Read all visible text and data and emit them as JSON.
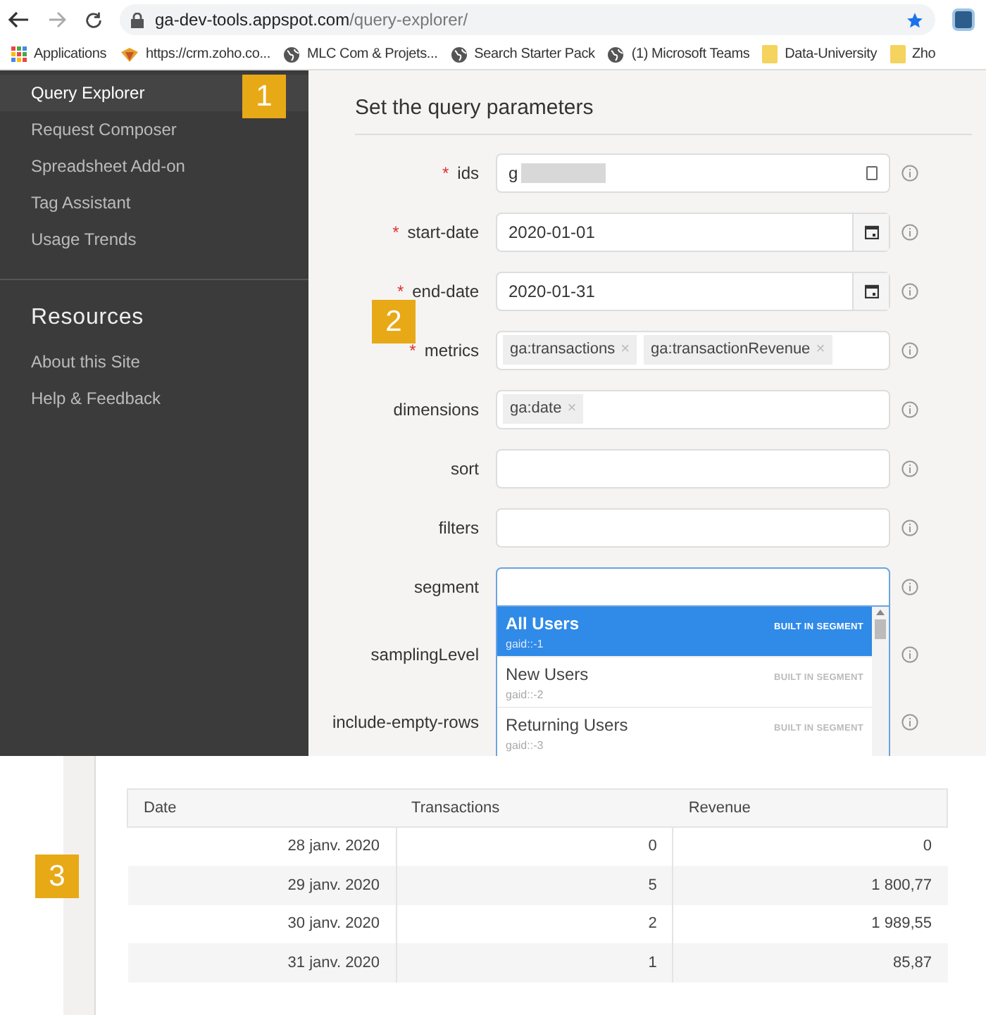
{
  "browser": {
    "url_host": "ga-dev-tools.appspot.com",
    "url_path": "/query-explorer/"
  },
  "bookmarks": [
    {
      "label": "Applications",
      "kind": "apps"
    },
    {
      "label": "https://crm.zoho.co...",
      "kind": "site"
    },
    {
      "label": "MLC Com & Projets...",
      "kind": "globe"
    },
    {
      "label": "Search Starter Pack",
      "kind": "globe"
    },
    {
      "label": "(1) Microsoft Teams",
      "kind": "globe"
    },
    {
      "label": "Data-University",
      "kind": "folder"
    },
    {
      "label": "Zho",
      "kind": "folder"
    }
  ],
  "sidebar": {
    "items": [
      {
        "label": "Query Explorer",
        "selected": true
      },
      {
        "label": "Request Composer",
        "selected": false
      },
      {
        "label": "Spreadsheet Add-on",
        "selected": false
      },
      {
        "label": "Tag Assistant",
        "selected": false
      },
      {
        "label": "Usage Trends",
        "selected": false
      }
    ],
    "resources_heading": "Resources",
    "resources": [
      {
        "label": "About this Site"
      },
      {
        "label": "Help & Feedback"
      }
    ]
  },
  "form": {
    "heading": "Set the query parameters",
    "remove_glyph": "×",
    "fields": [
      {
        "label": "ids",
        "required_mark": "*",
        "kind": "account",
        "value": "g"
      },
      {
        "label": "start-date",
        "required_mark": "*",
        "kind": "date",
        "value": "2020-01-01"
      },
      {
        "label": "end-date",
        "required_mark": "*",
        "kind": "date",
        "value": "2020-01-31"
      },
      {
        "label": "metrics",
        "required_mark": "*",
        "kind": "tags",
        "tags": [
          "ga:transactions",
          "ga:transactionRevenue"
        ]
      },
      {
        "label": "dimensions",
        "kind": "tags",
        "tags": [
          "ga:date"
        ]
      },
      {
        "label": "sort",
        "kind": "text"
      },
      {
        "label": "filters",
        "kind": "text"
      },
      {
        "label": "segment",
        "kind": "segment"
      },
      {
        "label": "samplingLevel",
        "kind": "hidden"
      },
      {
        "label": "include-empty-rows",
        "kind": "hidden"
      }
    ],
    "segment_options": [
      {
        "name": "All Users",
        "id": "gaid::-1",
        "tag": "BUILT IN SEGMENT",
        "selected": true
      },
      {
        "name": "New Users",
        "id": "gaid::-2",
        "tag": "BUILT IN SEGMENT",
        "selected": false
      },
      {
        "name": "Returning Users",
        "id": "gaid::-3",
        "tag": "BUILT IN SEGMENT",
        "selected": false
      }
    ]
  },
  "table": {
    "columns": [
      "Date",
      "Transactions",
      "Revenue"
    ],
    "rows": [
      [
        "28 janv. 2020",
        "0",
        "0"
      ],
      [
        "29 janv. 2020",
        "5",
        "1 800,77"
      ],
      [
        "30 janv. 2020",
        "2",
        "1 989,55"
      ],
      [
        "31 janv. 2020",
        "1",
        "85,87"
      ]
    ]
  },
  "annotations": [
    {
      "label": "1"
    },
    {
      "label": "2"
    },
    {
      "label": "3"
    }
  ]
}
